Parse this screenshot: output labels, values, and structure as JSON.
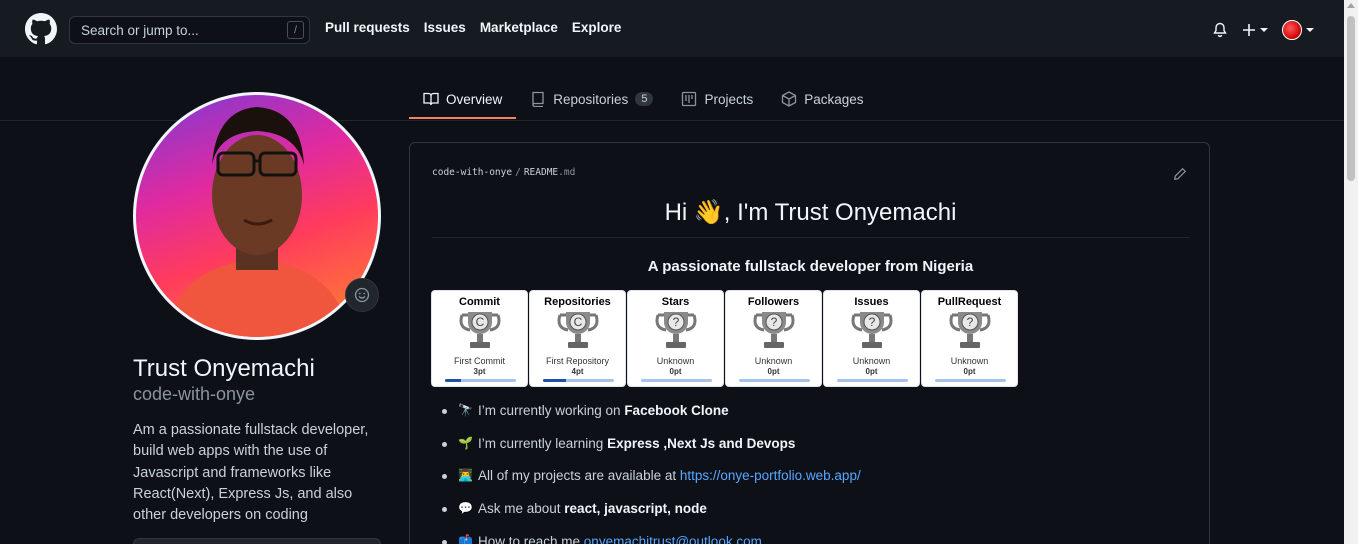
{
  "header": {
    "search_placeholder": "Search or jump to...",
    "search_key": "/",
    "nav": [
      "Pull requests",
      "Issues",
      "Marketplace",
      "Explore"
    ],
    "plus_label": "+"
  },
  "tabs": [
    {
      "label": "Overview",
      "icon": "book-icon",
      "active": true
    },
    {
      "label": "Repositories",
      "icon": "repo-icon",
      "count": "5"
    },
    {
      "label": "Projects",
      "icon": "project-icon"
    },
    {
      "label": "Packages",
      "icon": "package-icon"
    }
  ],
  "profile": {
    "name": "Trust Onyemachi",
    "username": "code-with-onye",
    "bio": "Am a passionate fullstack developer, build web apps with the use of Javascript and frameworks like React(Next), Express Js, and also other developers on coding"
  },
  "readme": {
    "owner": "code-with-onye",
    "separator": "/",
    "file": "README",
    "ext": ".md",
    "title": "Hi 👋, I'm Trust Onyemachi",
    "subtitle": "A passionate fullstack developer from Nigeria",
    "trophies": [
      {
        "title": "Commit",
        "letter": "C",
        "rank": "First Commit",
        "points": "3pt",
        "progress": 0.22
      },
      {
        "title": "Repositories",
        "letter": "C",
        "rank": "First Repository",
        "points": "4pt",
        "progress": 0.33
      },
      {
        "title": "Stars",
        "letter": "?",
        "rank": "Unknown",
        "points": "0pt",
        "progress": 0
      },
      {
        "title": "Followers",
        "letter": "?",
        "rank": "Unknown",
        "points": "0pt",
        "progress": 0
      },
      {
        "title": "Issues",
        "letter": "?",
        "rank": "Unknown",
        "points": "0pt",
        "progress": 0
      },
      {
        "title": "PullRequest",
        "letter": "?",
        "rank": "Unknown",
        "points": "0pt",
        "progress": 0
      }
    ],
    "bullets": [
      {
        "emoji": "🔭",
        "text": "I’m currently working on ",
        "bold": "Facebook Clone"
      },
      {
        "emoji": "🌱",
        "text": "I’m currently learning ",
        "bold": "Express ,Next Js and Devops"
      },
      {
        "emoji": "👨‍💻",
        "text": "All of my projects are available at ",
        "link": "https://onye-portfolio.web.app/"
      },
      {
        "emoji": "💬",
        "text": "Ask me about ",
        "bold": "react, javascript, node"
      },
      {
        "emoji": "📫",
        "text": "How to reach me ",
        "link": "onyemachitrust@outlook.com"
      }
    ]
  },
  "colors": {
    "bg": "#0d1117",
    "header_bg": "#161b22",
    "accent_underline": "#f78166",
    "link": "#58a6ff"
  }
}
